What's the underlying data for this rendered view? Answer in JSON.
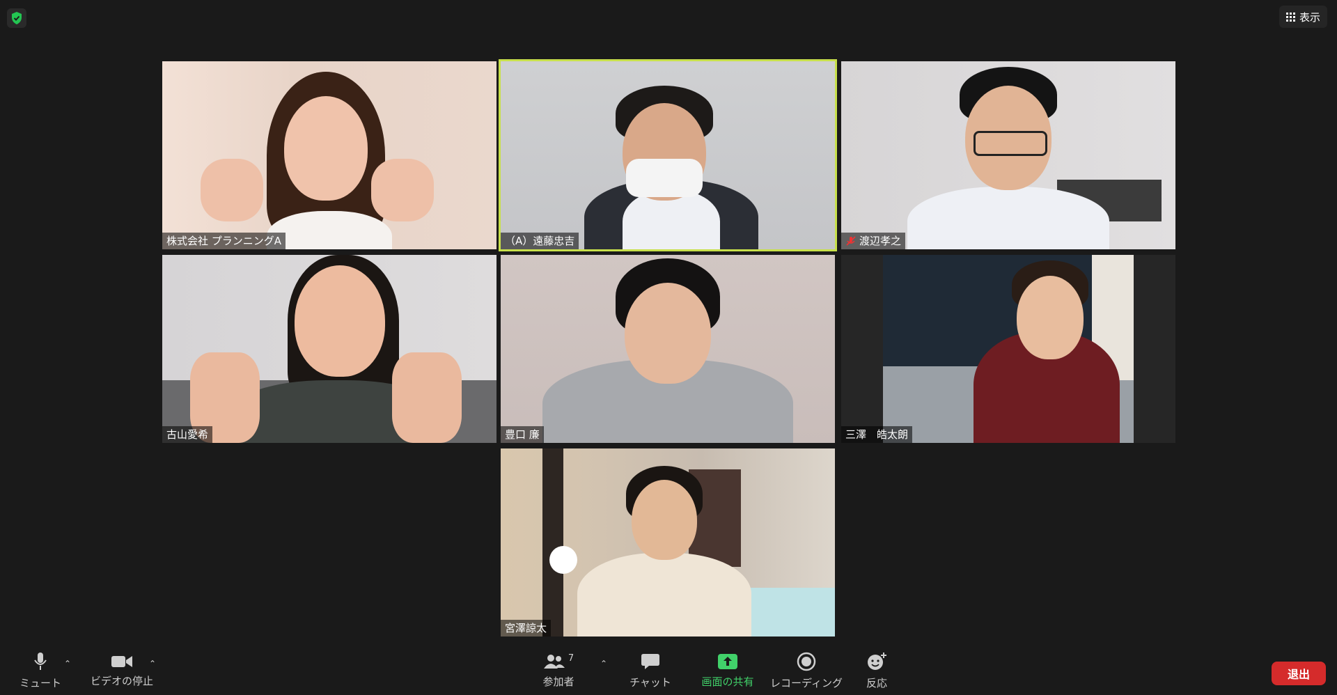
{
  "top": {
    "view_label": "表示"
  },
  "participants": [
    {
      "name": "株式会社 プランニングA",
      "muted": false,
      "active": false
    },
    {
      "name": "（A）遠藤忠吉",
      "muted": false,
      "active": true
    },
    {
      "name": "渡辺孝之",
      "muted": true,
      "active": false
    },
    {
      "name": "古山愛希",
      "muted": false,
      "active": false
    },
    {
      "name": "豊口 廉",
      "muted": false,
      "active": false
    },
    {
      "name": "三澤　皓太朗",
      "muted": false,
      "active": false
    },
    {
      "name": "宮澤諒太",
      "muted": false,
      "active": false
    }
  ],
  "toolbar": {
    "mute_label": "ミュート",
    "video_label": "ビデオの停止",
    "participants_label": "参加者",
    "participants_count": "7",
    "chat_label": "チャット",
    "share_label": "画面の共有",
    "record_label": "レコーディング",
    "reactions_label": "反応",
    "leave_label": "退出"
  },
  "colors": {
    "background": "#1a1a1a",
    "active_speaker_border": "#c8e04b",
    "share_green": "#41d16a",
    "leave_red": "#d52b2b",
    "security_green": "#23c552"
  },
  "icons": [
    "shield-check-icon",
    "grid-view-icon",
    "microphone-icon",
    "video-camera-icon",
    "participants-icon",
    "chat-icon",
    "share-screen-icon",
    "record-icon",
    "reaction-icon",
    "muted-mic-icon",
    "caret-up-icon"
  ]
}
